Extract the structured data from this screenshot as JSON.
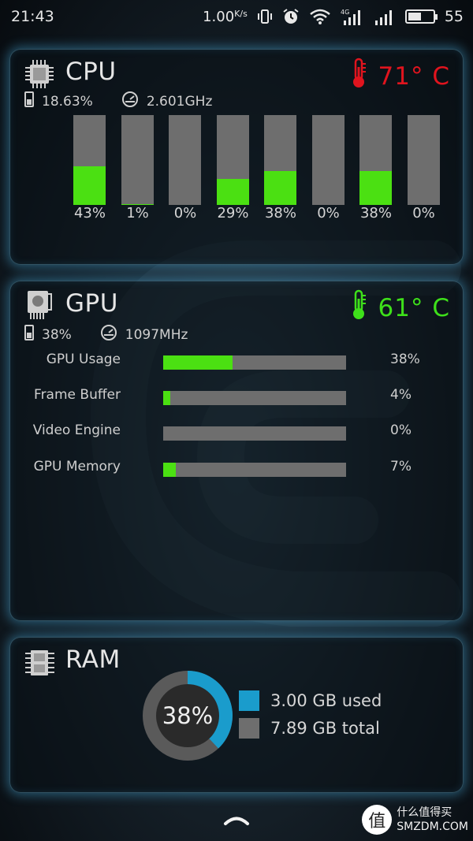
{
  "status_bar": {
    "time": "21:43",
    "net_speed": "1.00",
    "net_speed_unit": "K/s",
    "network_type": "4G",
    "battery": "55",
    "battery_fraction": 0.55
  },
  "cpu": {
    "title": "CPU",
    "temperature": "71° C",
    "temp_color": "#e0141e",
    "usage": "18.63%",
    "frequency": "2.601GHz",
    "cores": [
      {
        "label": "43%",
        "value": 43
      },
      {
        "label": "1%",
        "value": 1
      },
      {
        "label": "0%",
        "value": 0
      },
      {
        "label": "29%",
        "value": 29
      },
      {
        "label": "38%",
        "value": 38
      },
      {
        "label": "0%",
        "value": 0
      },
      {
        "label": "38%",
        "value": 38
      },
      {
        "label": "0%",
        "value": 0
      }
    ]
  },
  "gpu": {
    "title": "GPU",
    "temperature": "61° C",
    "temp_color": "#3ee01a",
    "usage": "38%",
    "frequency": "1097MHz",
    "meters": [
      {
        "label": "GPU Usage",
        "value_text": "38%",
        "value": 38
      },
      {
        "label": "Frame Buffer",
        "value_text": "4%",
        "value": 4
      },
      {
        "label": "Video Engine",
        "value_text": "0%",
        "value": 0
      },
      {
        "label": "GPU Memory",
        "value_text": "7%",
        "value": 7
      }
    ]
  },
  "ram": {
    "title": "RAM",
    "percent": "38%",
    "used_fraction": 0.38,
    "used": "3.00 GB used",
    "total": "7.89 GB total",
    "used_color": "#1a9ccc",
    "free_color": "#6e6e6e"
  },
  "watermark": {
    "badge": "值",
    "line1": "什么值得买",
    "line2": "SMZDM.COM"
  },
  "colors": {
    "bar_fill": "#4be012",
    "bar_track": "#6e6e6e",
    "panel_glow": "#46aadc"
  },
  "icons": [
    "chip-icon",
    "gpu-card-icon",
    "ram-module-icon",
    "thermometer-icon",
    "speedometer-icon",
    "phone-usage-icon",
    "wifi-icon",
    "signal-icon",
    "alarm-icon",
    "vibrate-icon",
    "battery-icon",
    "chevron-up-icon"
  ]
}
